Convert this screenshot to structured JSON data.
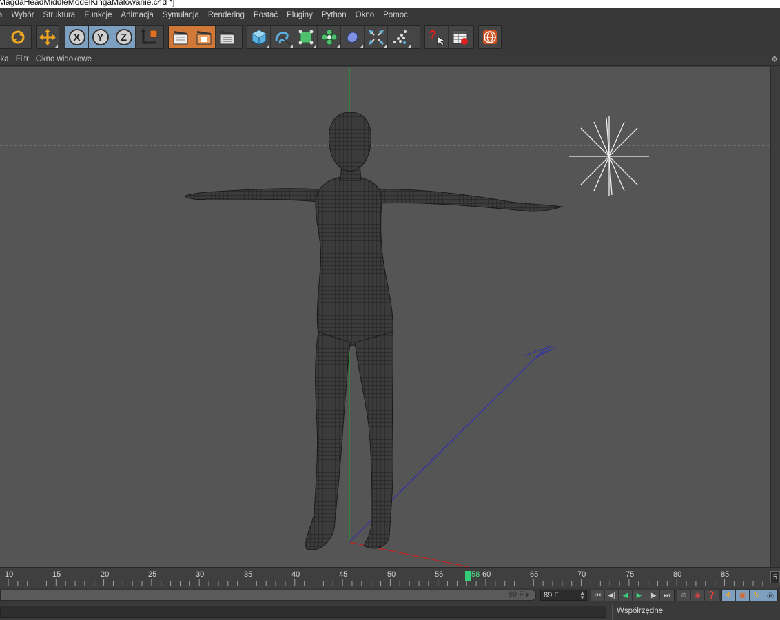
{
  "window": {
    "title": "MagdaHeadMiddleModelKingaMalowanie.c4d *]"
  },
  "menubar": {
    "items": [
      "a",
      "Wybór",
      "Struktura",
      "Funkcje",
      "Animacja",
      "Symulacja",
      "Rendering",
      "Postać",
      "Pluginy",
      "Python",
      "Okno",
      "Pomoc"
    ]
  },
  "toolbar": {
    "buttons": [
      "partial-tool-icon",
      "rotate-icon",
      "move-icon",
      "x-axis-lock-icon",
      "y-axis-lock-icon",
      "z-axis-lock-icon",
      "coordinate-system-icon",
      "render-view-icon",
      "render-picture-viewer-icon",
      "render-settings-icon",
      "cube-primitive-icon",
      "spline-pen-icon",
      "subdivision-surface-icon",
      "cloner-icon",
      "deformer-icon",
      "scene-effects-icon",
      "particles-icon",
      "help-pointer-icon",
      "help-table-icon",
      "web-globe-icon"
    ],
    "x_axis_label": "X",
    "y_axis_label": "Y",
    "z_axis_label": "Z",
    "help_label": "?"
  },
  "viewport_menu": {
    "items": [
      "ika",
      "Filtr",
      "Okno widokowe"
    ],
    "handle_icon": "move-cross-icon"
  },
  "viewport": {
    "background_color": "#555555",
    "model": "female base mesh in T-pose, dark wireframe",
    "light_object": "omni-light-icon",
    "axis_colors": {
      "x": "#c02020",
      "y": "#20a030",
      "z": "#3030b0"
    }
  },
  "timeline": {
    "tick_labels": [
      "10",
      "15",
      "20",
      "25",
      "30",
      "35",
      "40",
      "45",
      "50",
      "55",
      "60",
      "65",
      "70",
      "75",
      "80",
      "85"
    ],
    "current_frame": "58",
    "end_marker": "5"
  },
  "transport": {
    "range_end": "89 F",
    "frame_field": "89 F",
    "playback_buttons": [
      "go-to-start-icon",
      "previous-key-icon",
      "play-backwards-icon",
      "play-forwards-icon",
      "next-key-icon",
      "go-to-end-icon"
    ],
    "record_buttons": [
      "autokey-icon",
      "record-icon",
      "keyframe-help-icon"
    ],
    "key_type_buttons": [
      "position-key-icon",
      "scale-key-icon",
      "rotation-key-icon",
      "parameter-key-icon"
    ]
  },
  "panels": {
    "coordinates_title": "Współrzędne"
  }
}
